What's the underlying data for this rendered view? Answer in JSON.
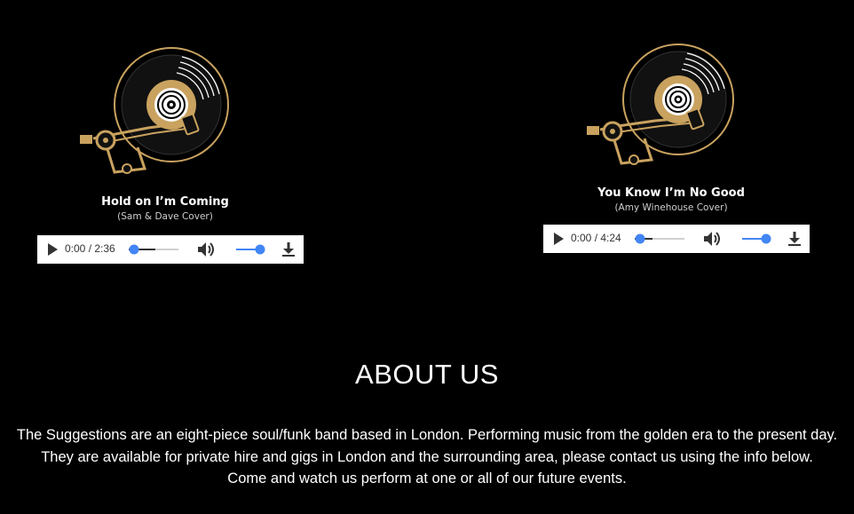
{
  "tracks": [
    {
      "title": "Hold on I’m Coming",
      "subtitle": "(Sam & Dave Cover)",
      "player": {
        "time": "0:00 / 2:36",
        "progress": 0,
        "volume": 1
      }
    },
    {
      "title": "You Know I’m No Good",
      "subtitle": "(Amy Winehouse Cover)",
      "player": {
        "time": "0:00 / 4:24",
        "progress": 0,
        "volume": 1
      }
    }
  ],
  "about": {
    "heading": "ABOUT US",
    "lines": [
      "The Suggestions are an eight-piece soul/funk band based in London. Performing music from the golden era to the present day.",
      "They are available for private hire and gigs in London and the surrounding area, please contact us using the info below.",
      "Come and watch us perform at one or all of our future events."
    ]
  },
  "colors": {
    "background": "#000000",
    "gold": "#c9a25f",
    "accent_blue": "#4285f4"
  },
  "icons": {
    "artwork": "vinyl-turntable-icon",
    "play": "play-icon",
    "volume": "volume-icon",
    "download": "download-icon"
  }
}
